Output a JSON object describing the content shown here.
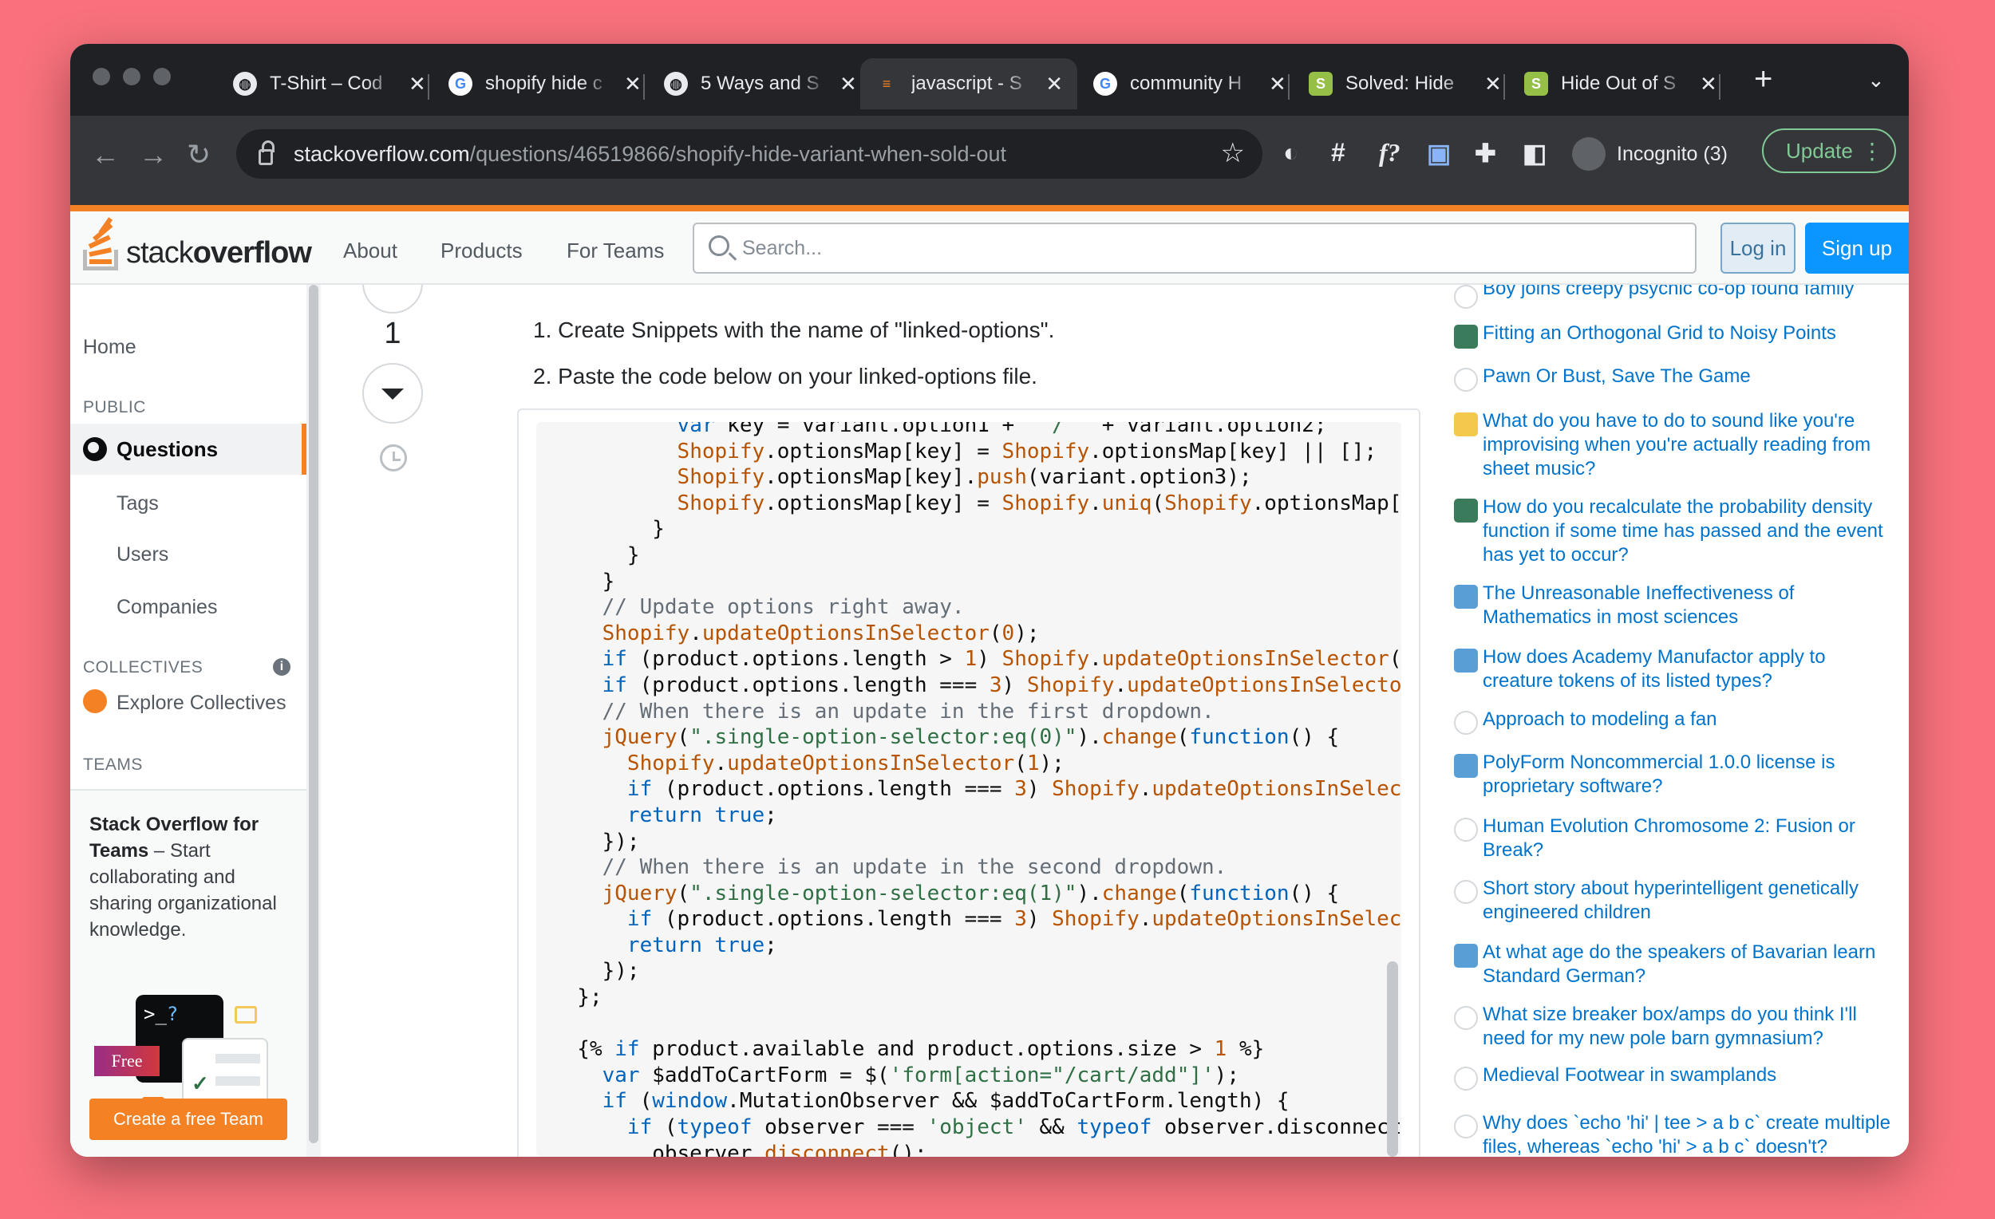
{
  "browser": {
    "tabs": [
      {
        "title": "T-Shirt – Cod",
        "favicon": "globe-icon",
        "active": false
      },
      {
        "title": "shopify hide c",
        "favicon": "google-icon",
        "active": false
      },
      {
        "title": "5 Ways and S",
        "favicon": "globe-icon",
        "active": false
      },
      {
        "title": "javascript - S",
        "favicon": "stackoverflow-icon",
        "active": true
      },
      {
        "title": "community H",
        "favicon": "google-icon",
        "active": false
      },
      {
        "title": "Solved: Hide",
        "favicon": "shopify-icon",
        "active": false
      },
      {
        "title": "Hide Out of S",
        "favicon": "shopify-icon",
        "active": false
      }
    ],
    "url_domain": "stackoverflow.com",
    "url_path": "/questions/46519866/shopify-hide-variant-when-sold-out",
    "incognito_label": "Incognito (3)",
    "update_label": "Update"
  },
  "header": {
    "logo_text_light": "stack",
    "logo_text_bold": "overflow",
    "nav": [
      "About",
      "Products",
      "For Teams"
    ],
    "search_placeholder": "Search...",
    "login_label": "Log in",
    "signup_label": "Sign up"
  },
  "sidebar": {
    "home": "Home",
    "public_label": "PUBLIC",
    "questions": "Questions",
    "tags": "Tags",
    "users": "Users",
    "companies": "Companies",
    "collectives_label": "COLLECTIVES",
    "explore_collectives": "Explore Collectives",
    "teams_label": "TEAMS",
    "teams_promo_bold1": "Stack Overflow for",
    "teams_promo_bold2": "Teams",
    "teams_promo_rest": " – Start collaborating and sharing organizational knowledge.",
    "free_badge": "Free",
    "create_team": "Create a free Team"
  },
  "answer": {
    "vote_count": "1",
    "step1": "1. Create Snippets with the name of \"linked-options\".",
    "step2": "2. Paste the code below on your linked-options file."
  },
  "hot_questions": [
    {
      "title": "Boy joins creepy psychic co-op found family",
      "icon": "scifi-icon",
      "color": "#ffffff"
    },
    {
      "title": "Fitting an Orthogonal Grid to Noisy Points",
      "icon": "gis-icon",
      "color": "#3a7b5b"
    },
    {
      "title": "Pawn Or Bust, Save The Game",
      "icon": "puzzling-icon",
      "color": "#ffffff"
    },
    {
      "title": "What do you have to do to sound like you're improvising when you're actually reading from sheet music?",
      "icon": "music-icon",
      "color": "#f2c94c"
    },
    {
      "title": "How do you recalculate the probability density function if some time has passed and the event has yet to occur?",
      "icon": "stats-icon",
      "color": "#3a7b5b"
    },
    {
      "title": "The Unreasonable Ineffectiveness of Mathematics in most sciences",
      "icon": "philosophy-icon",
      "color": "#5a9ed6"
    },
    {
      "title": "How does Academy Manufactor apply to creature tokens of its listed types?",
      "icon": "boardgames-icon",
      "color": "#5a9ed6"
    },
    {
      "title": "Approach to modeling a fan",
      "icon": "blender-icon",
      "color": "#ffffff"
    },
    {
      "title": "PolyForm Noncommercial 1.0.0 license is proprietary software?",
      "icon": "opensource-icon",
      "color": "#5a9ed6"
    },
    {
      "title": "Human Evolution Chromosome 2: Fusion or Break?",
      "icon": "biology-icon",
      "color": "#ffffff"
    },
    {
      "title": "Short story about hyperintelligent genetically engineered children",
      "icon": "scifi-icon",
      "color": "#ffffff"
    },
    {
      "title": "At what age do the speakers of Bavarian learn Standard German?",
      "icon": "german-icon",
      "color": "#5a9ed6"
    },
    {
      "title": "What size breaker box/amps do you think I'll need for my new pole barn gymnasium?",
      "icon": "diy-icon",
      "color": "#ffffff"
    },
    {
      "title": "Medieval Footwear in swamplands",
      "icon": "worldbuilding-icon",
      "color": "#ffffff"
    },
    {
      "title": "Why does `echo 'hi' | tee > a b c` create multiple files, whereas `echo 'hi' > a b c` doesn't?",
      "icon": "unix-icon",
      "color": "#ffffff"
    }
  ]
}
